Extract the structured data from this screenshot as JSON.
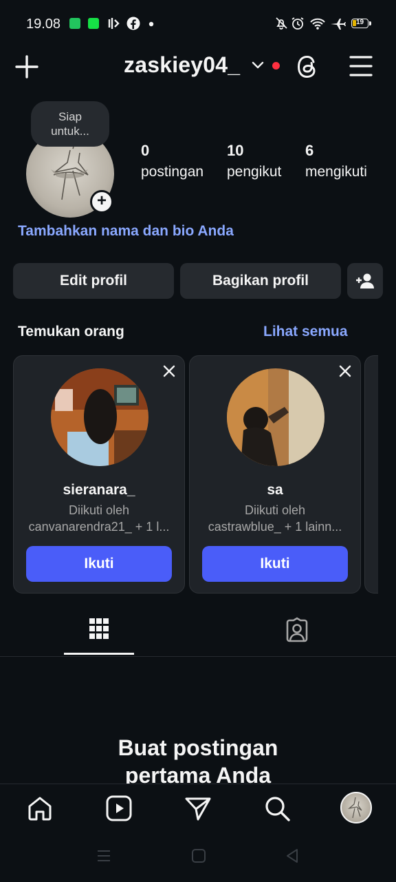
{
  "status_bar": {
    "time": "19.08",
    "battery": "19",
    "colors": {
      "green": "#22c55e",
      "bright_green": "#16e046"
    }
  },
  "header": {
    "username": "zaskiey04_"
  },
  "profile": {
    "note_bubble": "Siap\nuntuk...",
    "stats": [
      {
        "value": "0",
        "label": "postingan"
      },
      {
        "value": "10",
        "label": "pengikut"
      },
      {
        "value": "6",
        "label": "mengikuti"
      }
    ],
    "add_bio_link": "Tambahkan nama dan bio Anda",
    "buttons": {
      "edit": "Edit profil",
      "share": "Bagikan profil"
    }
  },
  "discover": {
    "title": "Temukan orang",
    "see_all": "Lihat semua",
    "cards": [
      {
        "name": "sieranara_",
        "line1": "Diikuti oleh",
        "line2": "canvanarendra21_ + 1 l...",
        "button": "Ikuti"
      },
      {
        "name": "sa",
        "line1": "Diikuti oleh",
        "line2": "castrawblue_ + 1 lainn...",
        "button": "Ikuti"
      }
    ]
  },
  "empty_state": {
    "line1": "Buat postingan",
    "line2": "pertama Anda"
  },
  "colors": {
    "accent_link": "#8aa8ff",
    "follow_button": "#4a5df9",
    "notification_dot": "#ff3040",
    "background": "#0c1014"
  }
}
